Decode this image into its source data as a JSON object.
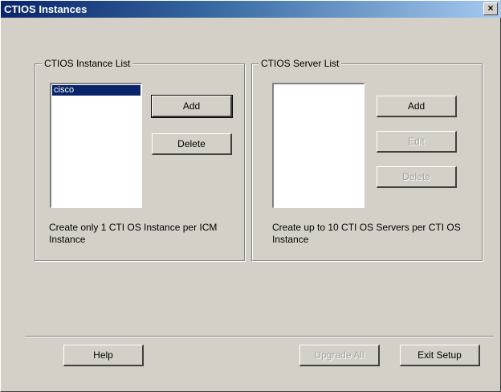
{
  "window": {
    "title": "CTIOS Instances",
    "close_label": "×"
  },
  "instance_group": {
    "label": "CTIOS Instance List",
    "items": [
      "cisco"
    ],
    "add_label": "Add",
    "delete_label": "Delete",
    "note": "Create only 1 CTI OS Instance per ICM Instance"
  },
  "server_group": {
    "label": "CTIOS Server List",
    "items": [],
    "add_label": "Add",
    "edit_label": "Edit",
    "delete_label": "Delete",
    "note": "Create up to 10 CTI OS Servers per CTI OS Instance"
  },
  "footer": {
    "help_label": "Help",
    "upgrade_label": "Upgrade All",
    "exit_label": "Exit Setup"
  }
}
